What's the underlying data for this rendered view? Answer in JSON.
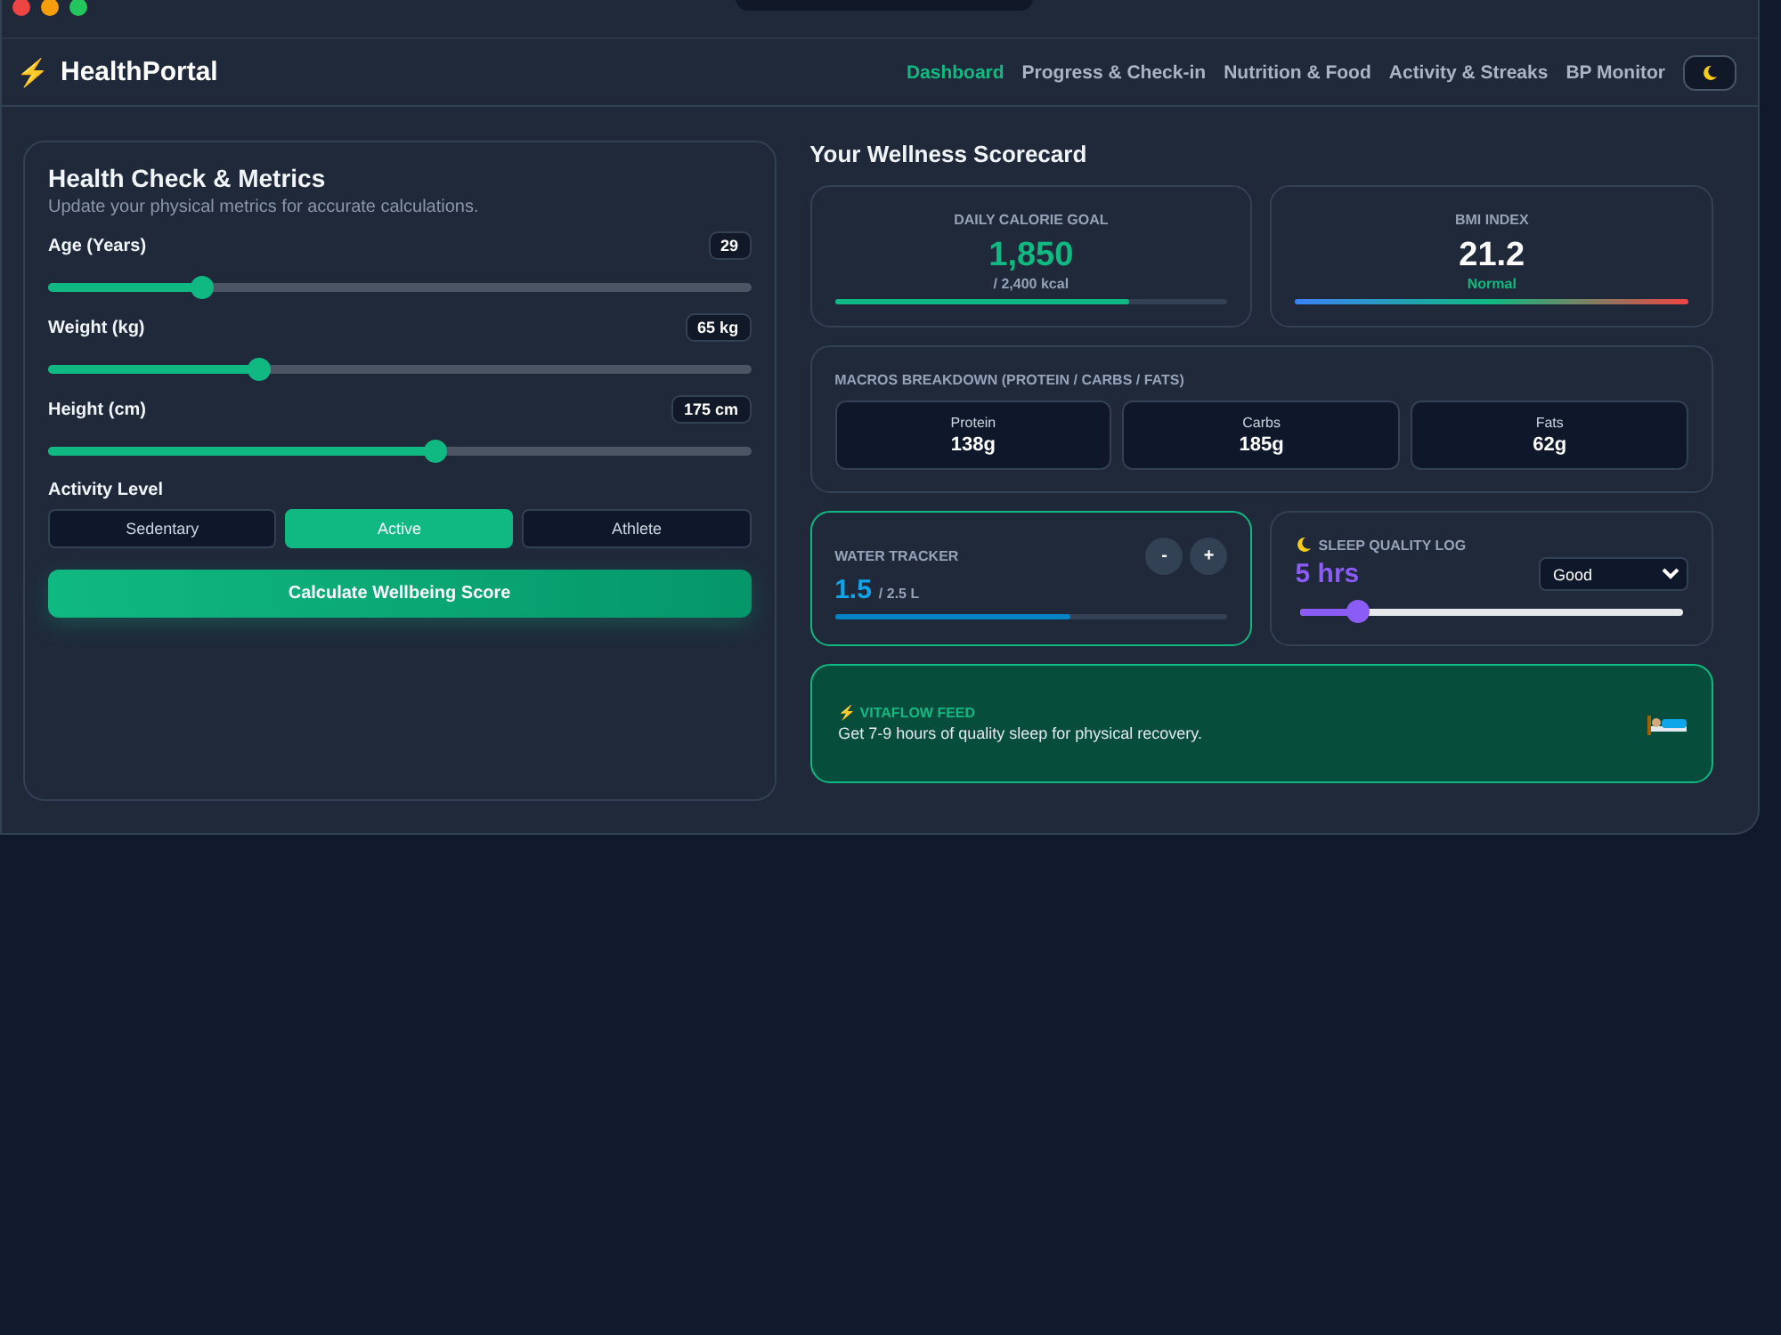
{
  "brand": {
    "icon": "⚡",
    "name": "HealthPortal"
  },
  "nav": [
    {
      "label": "Dashboard",
      "selected": true
    },
    {
      "label": "Progress & Check-in",
      "selected": false
    },
    {
      "label": "Nutrition & Food",
      "selected": false
    },
    {
      "label": "Activity & Streaks",
      "selected": false
    },
    {
      "label": "BP Monitor",
      "selected": false
    }
  ],
  "metrics": {
    "title": "Health Check & Metrics",
    "subtitle": "Update your physical metrics for accurate calculations.",
    "sliders": [
      {
        "label": "Age (Years)",
        "value": "29",
        "level": 0.22
      },
      {
        "label": "Weight (kg)",
        "value": "65 kg",
        "level": 0.3
      },
      {
        "label": "Height (cm)",
        "value": "175 cm",
        "level": 0.55
      }
    ],
    "activity_label": "Activity Level",
    "activity": [
      {
        "label": "Sedentary",
        "selected": false
      },
      {
        "label": "Active",
        "selected": true
      },
      {
        "label": "Athlete",
        "selected": false
      }
    ],
    "button": "Calculate Wellbeing Score"
  },
  "scorecard": {
    "title": "Your Wellness Scorecard",
    "calorie": {
      "label": "DAILY CALORIE GOAL",
      "value": "1,850",
      "sub": "/ 2,400 kcal",
      "level": 0.75
    },
    "bmi": {
      "label": "BMI INDEX",
      "value": "21.2",
      "status": "Normal"
    },
    "macros": {
      "label": "MACROS BREAKDOWN (PROTEIN / CARBS / FATS)",
      "items": [
        {
          "name": "Protein",
          "value": "138g"
        },
        {
          "name": "Carbs",
          "value": "185g"
        },
        {
          "name": "Fats",
          "value": "62g"
        }
      ]
    },
    "water": {
      "label": "WATER TRACKER",
      "minus": "-",
      "plus": "+",
      "value": "1.5",
      "unit": "/ 2.5 L",
      "level": 0.6
    },
    "sleep": {
      "label": "SLEEP QUALITY LOG",
      "value": "5 hrs",
      "quality": "Good",
      "level": 0.15
    },
    "feed": {
      "icon": "⚡",
      "label": "VITAFLOW FEED",
      "text": "Get 7-9 hours of quality sleep for physical recovery."
    }
  }
}
